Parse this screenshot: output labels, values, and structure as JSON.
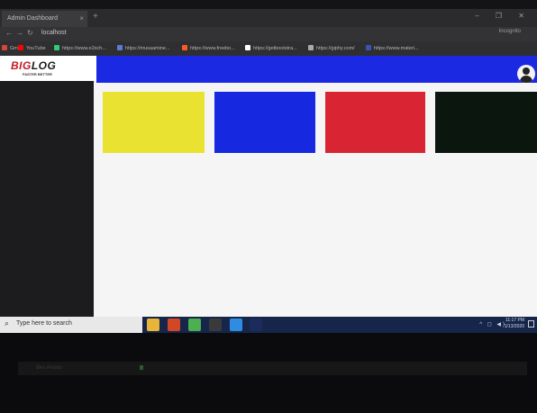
{
  "browser": {
    "tab_title": "Admin Dashboard",
    "tab_close": "×",
    "new_tab": "+",
    "window_controls": "–  ❐  ✕",
    "nav_back": "←",
    "nav_forward": "→",
    "nav_reload": "↻",
    "address": "localhost",
    "profile": "Incognito",
    "bookmarks": [
      {
        "label": "Gmail",
        "color": "#d44638"
      },
      {
        "label": "YouTube",
        "color": "#ff0000"
      },
      {
        "label": "https://www.e2sch...",
        "color": "#2ecc71"
      },
      {
        "label": "https://musaamine...",
        "color": "#5b7bd5"
      },
      {
        "label": "https://www.freebo...",
        "color": "#ff5722"
      },
      {
        "label": "https://getbootstra...",
        "color": "#ffffff"
      },
      {
        "label": "https://giphy.com/",
        "color": "#aaaaaa"
      },
      {
        "label": "https://www.materi...",
        "color": "#3f51b5"
      }
    ]
  },
  "app": {
    "logo": {
      "big": "BIG",
      "log": "LOG",
      "tagline": "FASTER BETTER"
    },
    "header_color": "#1b29e3",
    "cards": [
      {
        "name": "yellow-card",
        "color": "#e9e231"
      },
      {
        "name": "blue-card",
        "color": "#1628e0"
      },
      {
        "name": "red-card",
        "color": "#d92434"
      },
      {
        "name": "black-card",
        "color": "#0b160e"
      }
    ]
  },
  "taskbar": {
    "search_icon": "⌕",
    "search_placeholder": "Type here to search",
    "apps": [
      {
        "name": "file-explorer-icon",
        "color": "#e8b53a"
      },
      {
        "name": "powerpoint-icon",
        "color": "#d24726"
      },
      {
        "name": "chrome-icon",
        "color": "#4caf50"
      },
      {
        "name": "terminal-icon",
        "color": "#3a3a3a"
      },
      {
        "name": "vscode-icon",
        "color": "#2f8ce0"
      },
      {
        "name": "photoshop-icon",
        "color": "#1b2b5c"
      }
    ],
    "tray_icons": "^ ◻ ◀)",
    "time": "11:17 PM",
    "date": "1/13/2020"
  },
  "reflection_text": "Bes Ansoo"
}
